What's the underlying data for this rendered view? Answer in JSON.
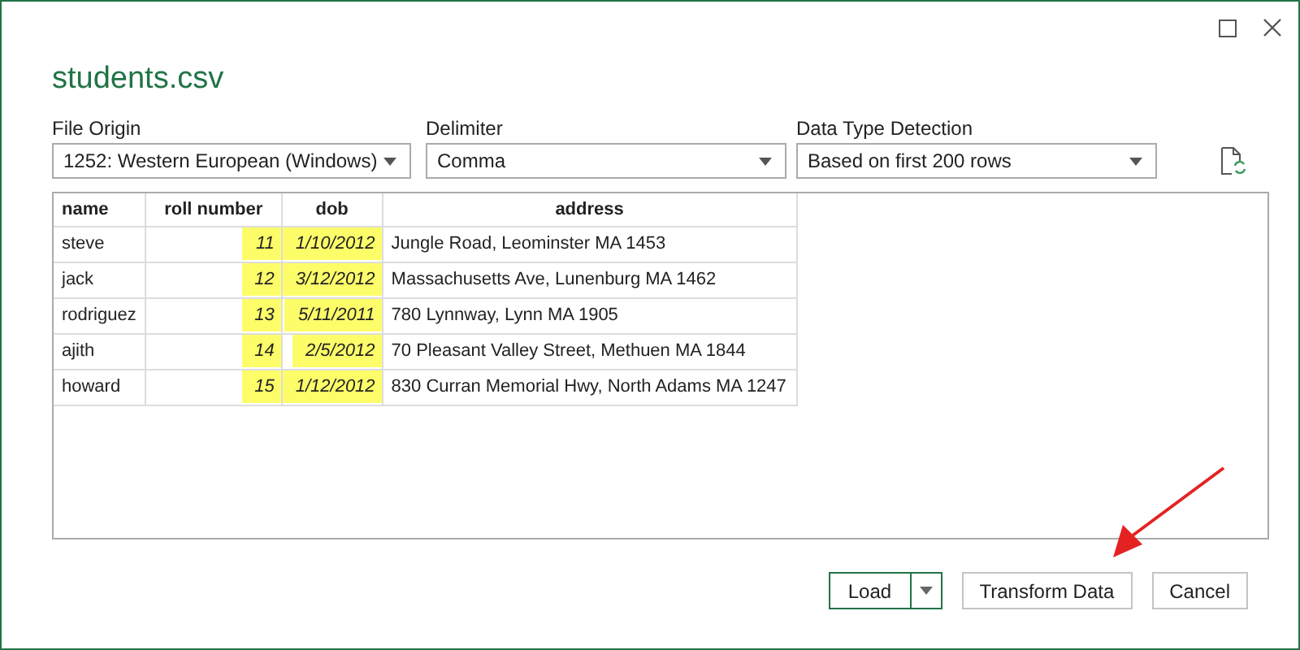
{
  "window": {
    "title": "students.csv"
  },
  "options": [
    {
      "label": "File Origin",
      "value": "1252: Western European (Windows)"
    },
    {
      "label": "Delimiter",
      "value": "Comma"
    },
    {
      "label": "Data Type Detection",
      "value": "Based on first 200 rows"
    }
  ],
  "table": {
    "columns": [
      {
        "label": "name",
        "kind": "text",
        "highlighted": false
      },
      {
        "label": "roll number",
        "kind": "number",
        "highlighted": true
      },
      {
        "label": "dob",
        "kind": "number",
        "highlighted": true
      },
      {
        "label": "address",
        "kind": "text",
        "highlighted": false
      }
    ],
    "rows": [
      [
        "steve",
        "11",
        "1/10/2012",
        "Jungle Road, Leominster MA 1453"
      ],
      [
        "jack",
        "12",
        "3/12/2012",
        "Massachusetts Ave, Lunenburg MA 1462"
      ],
      [
        "rodriguez",
        "13",
        "5/11/2011",
        "780 Lynnway, Lynn MA 1905"
      ],
      [
        "ajith",
        "14",
        "2/5/2012",
        "70 Pleasant Valley Street, Methuen MA 1844"
      ],
      [
        "howard",
        "15",
        "1/12/2012",
        "830 Curran Memorial Hwy, North Adams MA 1247"
      ]
    ]
  },
  "buttons": [
    {
      "label": "Load",
      "kind": "split"
    },
    {
      "label": "Transform Data",
      "kind": "plain"
    },
    {
      "label": "Cancel",
      "kind": "plain"
    }
  ]
}
